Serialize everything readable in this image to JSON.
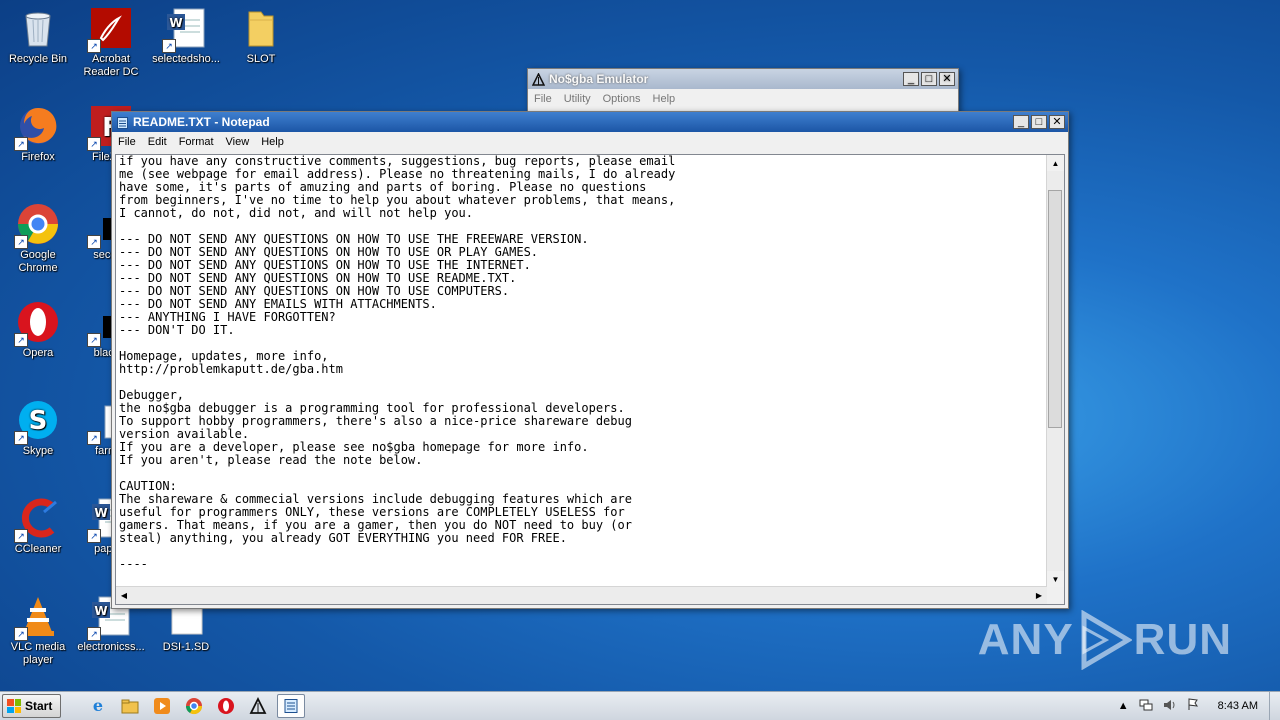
{
  "desktop": {
    "icons": [
      {
        "label": "Recycle Bin",
        "icon": "recycle-bin-icon"
      },
      {
        "label": "Acrobat Reader DC",
        "icon": "acrobat-icon"
      },
      {
        "label": "selectedsho...",
        "icon": "word-doc-icon"
      },
      {
        "label": "SLOT",
        "icon": "folder-icon"
      },
      {
        "label": "Firefox",
        "icon": "firefox-icon"
      },
      {
        "label": "FileZilla",
        "icon": "filezilla-icon"
      },
      {
        "label": "Google Chrome",
        "icon": "chrome-icon"
      },
      {
        "label": "second",
        "icon": "black-file-icon"
      },
      {
        "label": "Opera",
        "icon": "opera-icon"
      },
      {
        "label": "blackm",
        "icon": "black-file-icon"
      },
      {
        "label": "Skype",
        "icon": "skype-icon"
      },
      {
        "label": "farmor",
        "icon": "file-icon"
      },
      {
        "label": "CCleaner",
        "icon": "ccleaner-icon"
      },
      {
        "label": "papers",
        "icon": "word-doc-icon"
      },
      {
        "label": "VLC media player",
        "icon": "vlc-icon"
      },
      {
        "label": "electronicss...",
        "icon": "word-doc-icon"
      },
      {
        "label": "DSI-1.SD",
        "icon": "blank-file-icon"
      }
    ]
  },
  "nogba_window": {
    "title": "No$gba Emulator",
    "menu": [
      "File",
      "Utility",
      "Options",
      "Help"
    ]
  },
  "notepad_window": {
    "title": "README.TXT - Notepad",
    "menu": [
      "File",
      "Edit",
      "Format",
      "View",
      "Help"
    ],
    "lines": [
      "if you have any constructive comments, suggestions, bug reports, please email",
      "me (see webpage for email address). Please no threatening mails, I do already",
      "have some, it's parts of amuzing and parts of boring. Please no questions",
      "from beginners, I've no time to help you about whatever problems, that means,",
      "I cannot, do not, did not, and will not help you.",
      "",
      "--- DO NOT SEND ANY QUESTIONS ON HOW TO USE THE FREEWARE VERSION.",
      "--- DO NOT SEND ANY QUESTIONS ON HOW TO USE OR PLAY GAMES.",
      "--- DO NOT SEND ANY QUESTIONS ON HOW TO USE THE INTERNET.",
      "--- DO NOT SEND ANY QUESTIONS ON HOW TO USE README.TXT.",
      "--- DO NOT SEND ANY QUESTIONS ON HOW TO USE COMPUTERS.",
      "--- DO NOT SEND ANY EMAILS WITH ATTACHMENTS.",
      "--- ANYTHING I HAVE FORGOTTEN?",
      "--- DON'T DO IT.",
      "",
      "Homepage, updates, more info,",
      "http://problemkaputt.de/gba.htm",
      "",
      "Debugger,",
      "the no$gba debugger is a programming tool for professional developers.",
      "To support hobby programmers, there's also a nice-price shareware debug",
      "version available.",
      "If you are a developer, please see no$gba homepage for more info.",
      "If you aren't, please read the note below.",
      "",
      "CAUTION:",
      "The shareware & commecial versions include debugging features which are",
      "useful for programmers ONLY, these versions are COMPLETELY USELESS for",
      "gamers. That means, if you are a gamer, then you do NOT need to buy (or",
      "steal) anything, you already GOT EVERYTHING you need FOR FREE.",
      "",
      "----"
    ]
  },
  "taskbar": {
    "start_label": "Start",
    "clock": "8:43 AM",
    "pinned": [
      "ie-icon",
      "explorer-icon",
      "media-player-icon",
      "chrome-icon",
      "opera-icon",
      "nogba-icon",
      "notepad-icon"
    ]
  },
  "watermark": {
    "text_left": "ANY",
    "text_right": "RUN"
  }
}
